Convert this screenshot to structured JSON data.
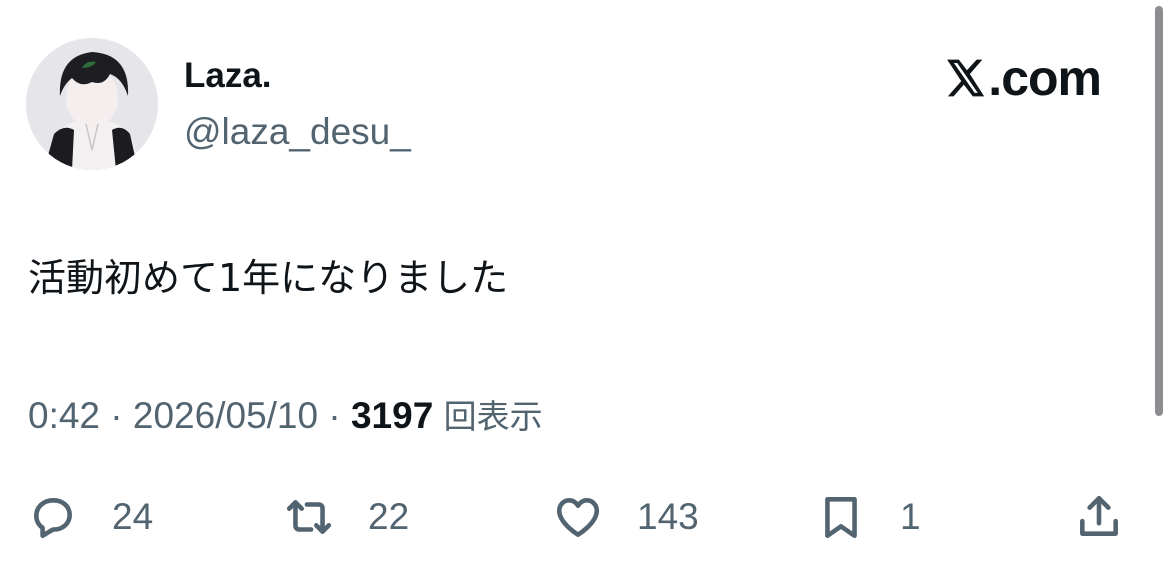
{
  "author": {
    "display_name": "Laza.",
    "handle": "@laza_desu_"
  },
  "brand": {
    "label": ".com",
    "logo_icon": "x-logo-icon"
  },
  "tweet": {
    "text": "活動初めて1年になりました"
  },
  "meta": {
    "time": "0:42",
    "separator_1": "·",
    "date": "2026/05/10",
    "separator_2": "·",
    "views_count": "3197",
    "views_label": "回表示"
  },
  "actions": {
    "replies": {
      "icon": "reply-icon",
      "count": "24"
    },
    "reposts": {
      "icon": "repost-icon",
      "count": "22"
    },
    "likes": {
      "icon": "heart-icon",
      "count": "143"
    },
    "bookmarks": {
      "icon": "bookmark-icon",
      "count": "1"
    },
    "share": {
      "icon": "share-icon"
    }
  },
  "colors": {
    "text_primary": "#0f1419",
    "text_secondary": "#536471",
    "background": "#ffffff"
  }
}
